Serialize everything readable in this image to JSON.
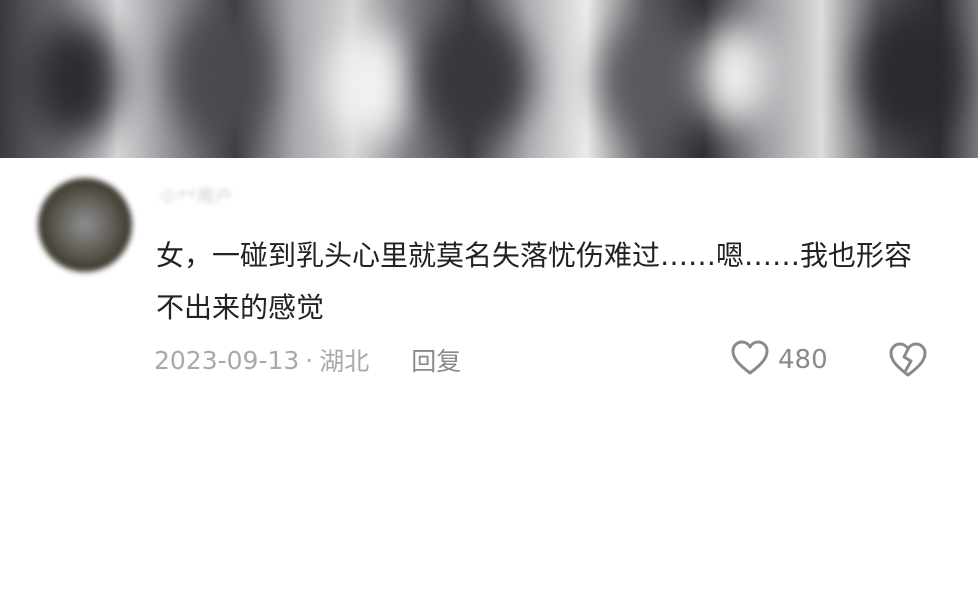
{
  "comment": {
    "username": "小**用户",
    "text": "女，一碰到乳头心里就莫名失落忧伤难过……嗯……我也形容不出来的感觉",
    "date": "2023-09-13",
    "separator": "·",
    "location": "湖北",
    "reply_label": "回复",
    "like_count": "480",
    "icons": {
      "like": "heart-outline-icon",
      "dislike": "broken-heart-icon"
    }
  },
  "colors": {
    "text": "#222222",
    "meta": "#a9a9a9",
    "icon": "#8a8a8a"
  }
}
